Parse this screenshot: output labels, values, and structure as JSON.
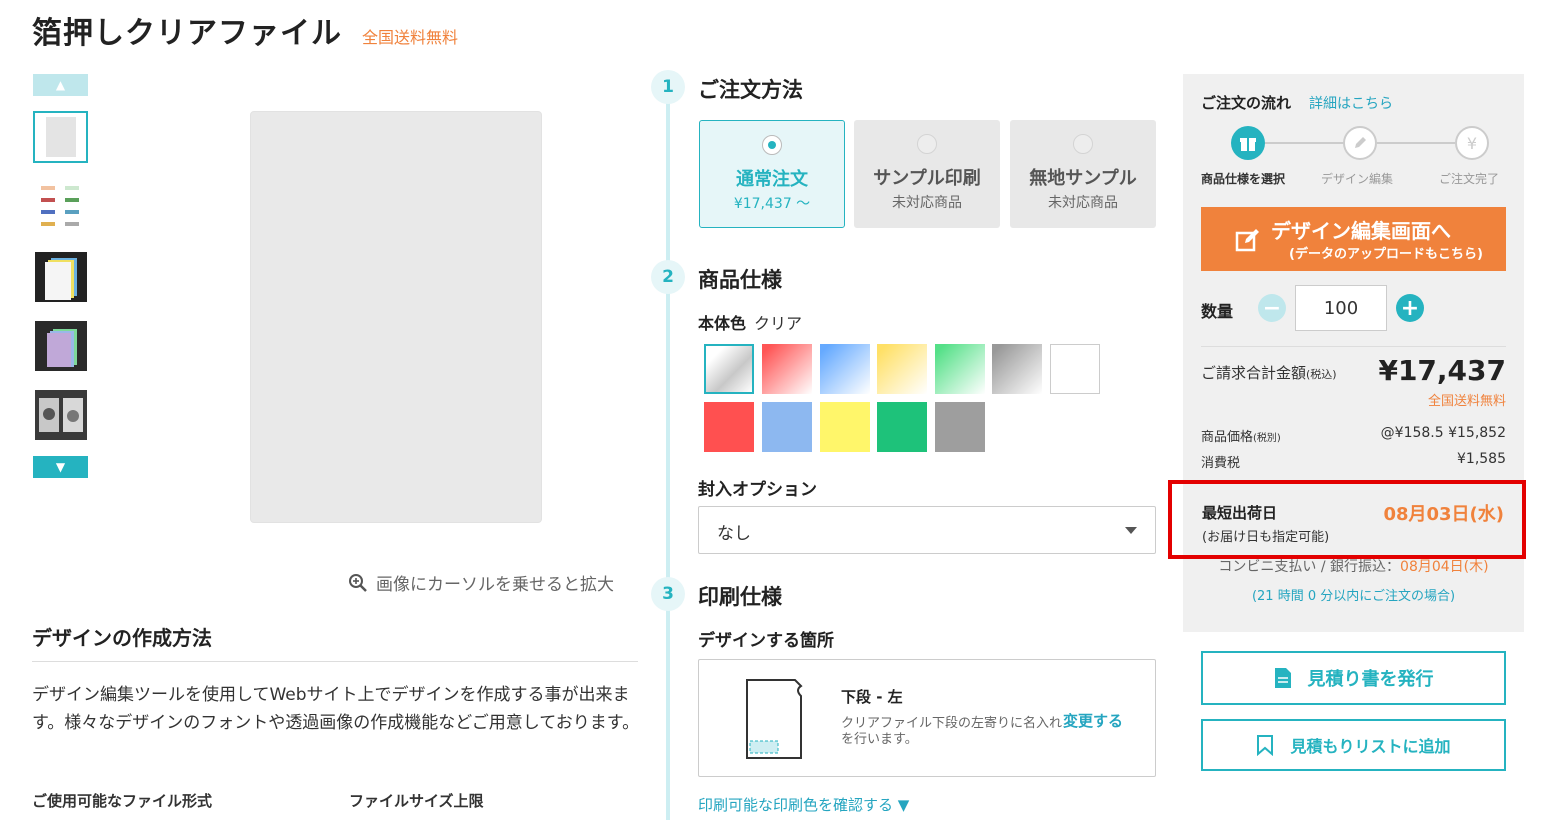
{
  "header": {
    "title": "箔押しクリアファイル",
    "free_shipping": "全国送料無料"
  },
  "gallery": {
    "zoom_hint": "画像にカーソルを乗せると拡大"
  },
  "design_method": {
    "title": "デザインの作成方法",
    "description": "デザイン編集ツールを使用してWebサイト上でデザインを作成する事が出来ます。様々なデザインのフォントや透過画像の作成機能などご用意しております。",
    "file_formats_label": "ご使用可能なファイル形式",
    "file_size_label": "ファイルサイズ上限"
  },
  "steps": [
    {
      "num": "1",
      "title": "ご注文方法"
    },
    {
      "num": "2",
      "title": "商品仕様"
    },
    {
      "num": "3",
      "title": "印刷仕様"
    }
  ],
  "order_methods": [
    {
      "label": "通常注文",
      "sub": "¥17,437 ～",
      "selected": true
    },
    {
      "label": "サンプル印刷",
      "sub": "未対応商品",
      "selected": false
    },
    {
      "label": "無地サンプル",
      "sub": "未対応商品",
      "selected": false
    }
  ],
  "body_color": {
    "label": "本体色",
    "value": "クリア"
  },
  "swatch_colors": {
    "row1": [
      "clear",
      "clear-red",
      "clear-blue",
      "clear-yellow",
      "clear-green",
      "clear-gray",
      "white"
    ],
    "row2": [
      "#ff5050",
      "#8db8f0",
      "#fff66a",
      "#1ec27a",
      "#9e9e9e"
    ]
  },
  "enclosure": {
    "label": "封入オプション",
    "value": "なし"
  },
  "print_area": {
    "label": "デザインする箇所",
    "title": "下段 - 左",
    "description": "クリアファイル下段の左寄りに名入れを行います。",
    "change": "変更する"
  },
  "print_color_link": "印刷可能な印刷色を確認する ▼",
  "flow": {
    "title": "ご注文の流れ",
    "link": "詳細はこちら",
    "steps": [
      "商品仕様を選択",
      "デザイン編集",
      "ご注文完了"
    ]
  },
  "design_button": {
    "line1": "デザイン編集画面へ",
    "line2": "(データのアップロードもこちら)"
  },
  "quantity": {
    "label": "数量",
    "value": "100"
  },
  "price": {
    "total_label": "ご請求合計金額",
    "tax_in": "(税込)",
    "total": "¥17,437",
    "free_shipping": "全国送料無料",
    "item_label": "商品価格",
    "tax_ex": "(税別)",
    "item_value": "@¥158.5 ¥15,852",
    "tax_label": "消費税",
    "tax_value": "¥1,585"
  },
  "shipping": {
    "label": "最短出荷日",
    "sub": "(お届け日も指定可能)",
    "date": "08月03日(水)",
    "pay_label": "コンビニ支払い / 銀行振込：",
    "pay_date": "08月04日(木)",
    "time_note": "(21 時間 0 分以内にご注文の場合)"
  },
  "actions": {
    "quote": "見積り書を発行",
    "add_list": "見積もりリストに追加"
  },
  "colors": {
    "accent": "#25b3c0",
    "orange": "#f0823c",
    "highlight": "#e30000"
  }
}
